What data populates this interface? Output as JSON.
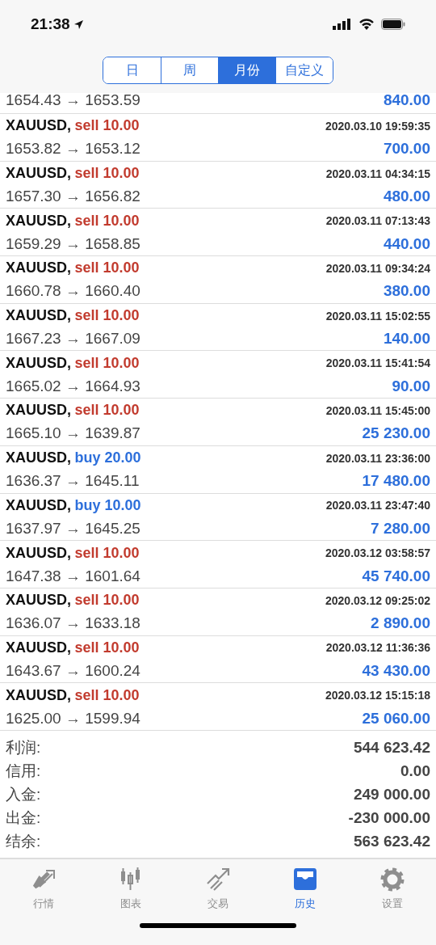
{
  "status_bar": {
    "time": "21:38"
  },
  "period_tabs": [
    {
      "label": "日",
      "selected": false
    },
    {
      "label": "周",
      "selected": false
    },
    {
      "label": "月份",
      "selected": true
    },
    {
      "label": "自定义",
      "selected": false
    }
  ],
  "trades": [
    {
      "prices": "1654.43 → 1653.59",
      "profit": "840.00"
    },
    {
      "symbol": "XAUUSD,",
      "side": "sell",
      "volume": "10.00",
      "time": "2020.03.10 19:59:35",
      "prices": "1653.82 → 1653.12",
      "profit": "700.00"
    },
    {
      "symbol": "XAUUSD,",
      "side": "sell",
      "volume": "10.00",
      "time": "2020.03.11 04:34:15",
      "prices": "1657.30 → 1656.82",
      "profit": "480.00"
    },
    {
      "symbol": "XAUUSD,",
      "side": "sell",
      "volume": "10.00",
      "time": "2020.03.11 07:13:43",
      "prices": "1659.29 → 1658.85",
      "profit": "440.00"
    },
    {
      "symbol": "XAUUSD,",
      "side": "sell",
      "volume": "10.00",
      "time": "2020.03.11 09:34:24",
      "prices": "1660.78 → 1660.40",
      "profit": "380.00"
    },
    {
      "symbol": "XAUUSD,",
      "side": "sell",
      "volume": "10.00",
      "time": "2020.03.11 15:02:55",
      "prices": "1667.23 → 1667.09",
      "profit": "140.00"
    },
    {
      "symbol": "XAUUSD,",
      "side": "sell",
      "volume": "10.00",
      "time": "2020.03.11 15:41:54",
      "prices": "1665.02 → 1664.93",
      "profit": "90.00"
    },
    {
      "symbol": "XAUUSD,",
      "side": "sell",
      "volume": "10.00",
      "time": "2020.03.11 15:45:00",
      "prices": "1665.10 → 1639.87",
      "profit": "25 230.00"
    },
    {
      "symbol": "XAUUSD,",
      "side": "buy",
      "volume": "20.00",
      "time": "2020.03.11 23:36:00",
      "prices": "1636.37 → 1645.11",
      "profit": "17 480.00"
    },
    {
      "symbol": "XAUUSD,",
      "side": "buy",
      "volume": "10.00",
      "time": "2020.03.11 23:47:40",
      "prices": "1637.97 → 1645.25",
      "profit": "7 280.00"
    },
    {
      "symbol": "XAUUSD,",
      "side": "sell",
      "volume": "10.00",
      "time": "2020.03.12 03:58:57",
      "prices": "1647.38 → 1601.64",
      "profit": "45 740.00"
    },
    {
      "symbol": "XAUUSD,",
      "side": "sell",
      "volume": "10.00",
      "time": "2020.03.12 09:25:02",
      "prices": "1636.07 → 1633.18",
      "profit": "2 890.00"
    },
    {
      "symbol": "XAUUSD,",
      "side": "sell",
      "volume": "10.00",
      "time": "2020.03.12 11:36:36",
      "prices": "1643.67 → 1600.24",
      "profit": "43 430.00"
    },
    {
      "symbol": "XAUUSD,",
      "side": "sell",
      "volume": "10.00",
      "time": "2020.03.12 15:15:18",
      "prices": "1625.00 → 1599.94",
      "profit": "25 060.00"
    }
  ],
  "summary": [
    {
      "label": "利润:",
      "value": "544 623.42"
    },
    {
      "label": "信用:",
      "value": "0.00"
    },
    {
      "label": "入金:",
      "value": "249 000.00"
    },
    {
      "label": "出金:",
      "value": "-230 000.00"
    },
    {
      "label": "结余:",
      "value": "563 623.42"
    }
  ],
  "tab_bar": [
    {
      "kind": "quotes",
      "label": "行情",
      "selected": false
    },
    {
      "kind": "chart",
      "label": "图表",
      "selected": false
    },
    {
      "kind": "trade",
      "label": "交易",
      "selected": false
    },
    {
      "kind": "history",
      "label": "历史",
      "selected": true
    },
    {
      "kind": "settings",
      "label": "设置",
      "selected": false
    }
  ]
}
